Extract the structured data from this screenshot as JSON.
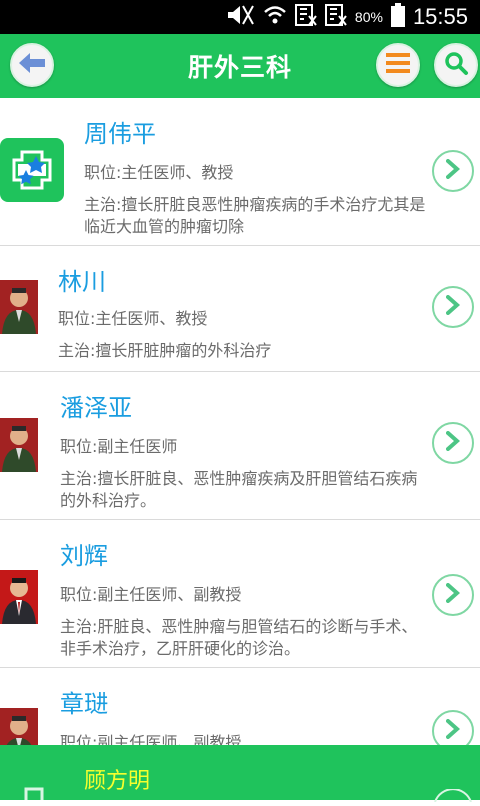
{
  "status_bar": {
    "battery": "80%",
    "time": "15:55"
  },
  "header": {
    "title": "肝外三科"
  },
  "doctors": [
    {
      "name": "周伟平",
      "position": "职位:主任医师、教授",
      "specialty": "主治:擅长肝脏良恶性肿瘤疾病的手术治疗尤其是临近大血管的肿瘤切除"
    },
    {
      "name": "林川",
      "position": "职位:主任医师、教授",
      "specialty": "主治:擅长肝脏肿瘤的外科治疗"
    },
    {
      "name": "潘泽亚",
      "position": "职位:副主任医师",
      "specialty": "主治:擅长肝脏良、恶性肿瘤疾病及肝胆管结石疾病的外科治疗。"
    },
    {
      "name": "刘辉",
      "position": "职位:副主任医师、副教授",
      "specialty": "主治:肝脏良、恶性肿瘤与胆管结石的诊断与手术、非手术治疗，乙肝肝硬化的诊治。"
    },
    {
      "name": "章琎",
      "position": "职位:副主任医师、副教授",
      "specialty": ""
    }
  ],
  "footer": {
    "name": "顾方明"
  },
  "colors": {
    "green": "#1fc35c",
    "blue_text": "#1a9de0",
    "yellow": "#f6ff2e"
  }
}
